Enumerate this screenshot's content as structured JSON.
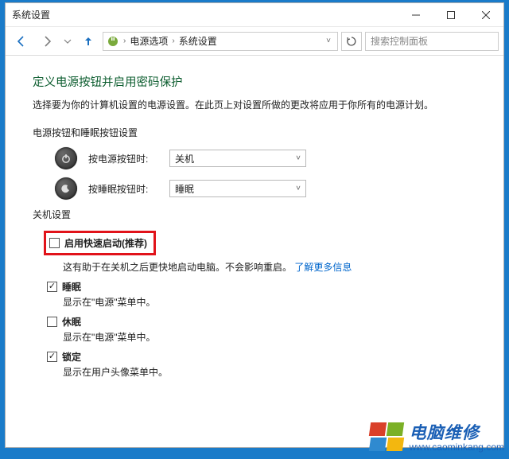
{
  "window": {
    "title": "系统设置"
  },
  "breadcrumb": {
    "item1": "电源选项",
    "item2": "系统设置"
  },
  "search": {
    "placeholder": "搜索控制面板"
  },
  "page": {
    "heading": "定义电源按钮并启用密码保护",
    "subtext": "选择要为你的计算机设置的电源设置。在此页上对设置所做的更改将应用于你所有的电源计划。"
  },
  "buttonSection": {
    "title": "电源按钮和睡眠按钮设置",
    "power": {
      "label": "按电源按钮时:",
      "value": "关机"
    },
    "sleep": {
      "label": "按睡眠按钮时:",
      "value": "睡眠"
    }
  },
  "shutdownSection": {
    "title": "关机设置",
    "fastStartup": {
      "checked": false,
      "label": "启用快速启动(推荐)",
      "desc_prefix": "这有助于在关机之后更快地启动电脑。不会影响重启。",
      "desc_link": "了解更多信息"
    },
    "sleep": {
      "checked": true,
      "label": "睡眠",
      "desc": "显示在\"电源\"菜单中。"
    },
    "hibernate": {
      "checked": false,
      "label": "休眠",
      "desc": "显示在\"电源\"菜单中。"
    },
    "lock": {
      "checked": true,
      "label": "锁定",
      "desc": "显示在用户头像菜单中。"
    }
  },
  "watermark": {
    "title": "电脑维修",
    "url": "www.caominkang.com"
  }
}
